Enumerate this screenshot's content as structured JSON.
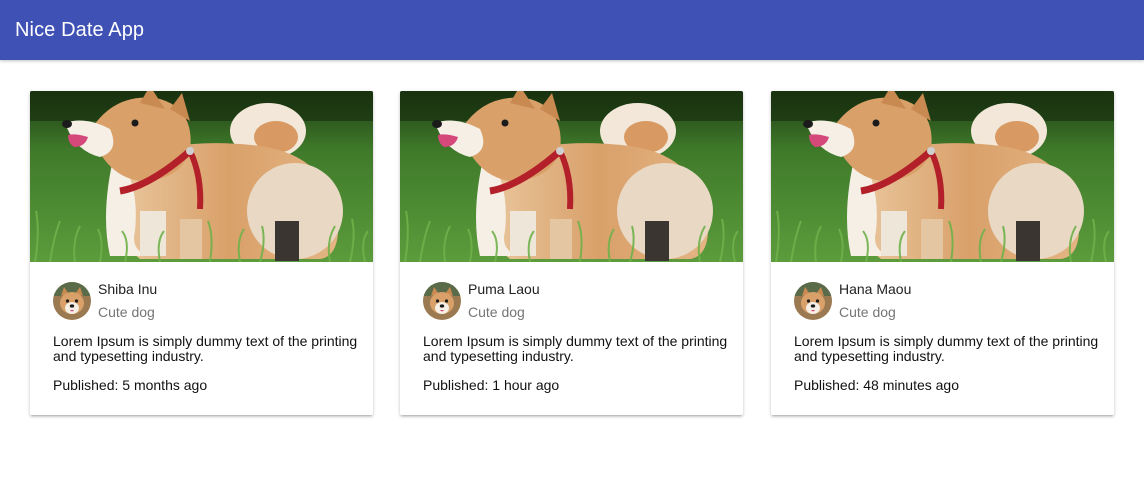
{
  "app": {
    "title": "Nice Date App",
    "accent": "#3f51b5"
  },
  "cards": [
    {
      "name": "Shiba Inu",
      "subtitle": "Cute dog",
      "text": "Lorem Ipsum is simply dummy text of the printing and typesetting industry.",
      "published": "Published: 5 months ago"
    },
    {
      "name": "Puma Laou",
      "subtitle": "Cute dog",
      "text": "Lorem Ipsum is simply dummy text of the printing and typesetting industry.",
      "published": "Published: 1 hour ago"
    },
    {
      "name": "Hana Maou",
      "subtitle": "Cute dog",
      "text": "Lorem Ipsum is simply dummy text of the printing and typesetting industry.",
      "published": "Published: 48 minutes ago"
    }
  ]
}
